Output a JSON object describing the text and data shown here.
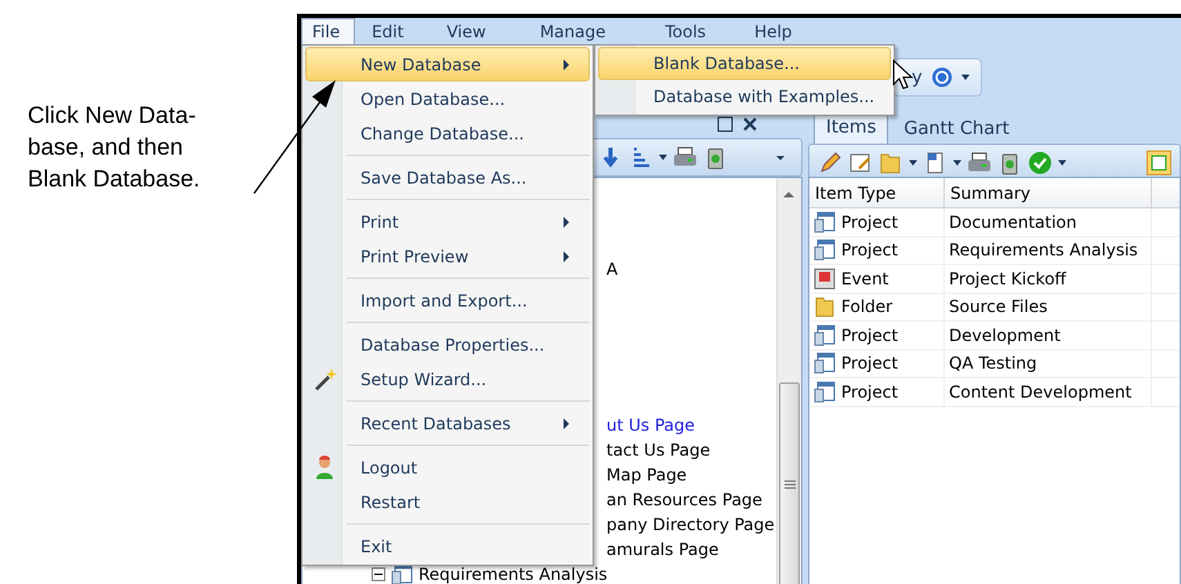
{
  "callout": {
    "text": "Click New Data-\nbase, and then\nBlank Database."
  },
  "menubar": [
    {
      "label": "File",
      "selected": true
    },
    {
      "label": "Edit",
      "selected": false
    },
    {
      "label": "View",
      "selected": false
    },
    {
      "label": "Manage",
      "selected": false
    },
    {
      "label": "Tools",
      "selected": false
    },
    {
      "label": "Help",
      "selected": false
    }
  ],
  "file_menu": {
    "groups": [
      [
        {
          "label": "New Database",
          "kind": "plain",
          "submenu": true,
          "selected": true
        },
        {
          "label": "Open Database...",
          "kind": "plain",
          "submenu": false,
          "selected": false
        },
        {
          "label": "Change Database...",
          "kind": "plain",
          "submenu": false,
          "selected": false
        }
      ],
      [
        {
          "label": "Save Database As...",
          "kind": "plain",
          "submenu": false,
          "selected": false
        }
      ],
      [
        {
          "label": "Print",
          "kind": "plain",
          "submenu": true,
          "selected": false
        },
        {
          "label": "Print Preview",
          "kind": "plain",
          "submenu": true,
          "selected": false
        }
      ],
      [
        {
          "label": "Import and Export...",
          "kind": "plain",
          "submenu": false,
          "selected": false
        }
      ],
      [
        {
          "label": "Database Properties...",
          "kind": "plain",
          "submenu": false,
          "selected": false
        },
        {
          "label": "Setup Wizard...",
          "kind": "wand",
          "submenu": false,
          "selected": false
        }
      ],
      [
        {
          "label": "Recent Databases",
          "kind": "plain",
          "submenu": true,
          "selected": false
        }
      ],
      [
        {
          "label": "Logout",
          "kind": "user",
          "submenu": false,
          "selected": false
        },
        {
          "label": "Restart",
          "kind": "plain",
          "submenu": false,
          "selected": false
        }
      ],
      [
        {
          "label": "Exit",
          "kind": "plain",
          "submenu": false,
          "selected": false
        }
      ]
    ]
  },
  "submenu": [
    {
      "label": "Blank Database...",
      "selected": true
    },
    {
      "label": "Database with Examples...",
      "selected": false
    }
  ],
  "top_toolbar": {
    "button_label": "y"
  },
  "left_pane": {
    "tree": [
      {
        "label": "A",
        "kind": "page",
        "selected": false
      },
      {
        "label": "ut Us Page",
        "kind": "page",
        "selected": true
      },
      {
        "label": "tact Us Page",
        "kind": "page",
        "selected": false
      },
      {
        "label": "Map Page",
        "kind": "page",
        "selected": false
      },
      {
        "label": "an Resources Page",
        "kind": "page",
        "selected": false
      },
      {
        "label": "pany Directory Page",
        "kind": "page",
        "selected": false
      },
      {
        "label": "amurals Page",
        "kind": "page",
        "selected": false
      },
      {
        "label": "Requirements Analysis",
        "kind": "node",
        "selected": false,
        "expanded": true
      }
    ]
  },
  "right_pane": {
    "tabs": [
      {
        "label": "Items",
        "selected": true
      },
      {
        "label": "Gantt Chart",
        "selected": false
      }
    ],
    "table": {
      "columns": [
        "Item Type",
        "Summary"
      ],
      "rows": [
        {
          "kind": "project",
          "item_type": "Project",
          "summary": "Documentation"
        },
        {
          "kind": "project",
          "item_type": "Project",
          "summary": "Requirements Analysis"
        },
        {
          "kind": "event",
          "item_type": "Event",
          "summary": "Project Kickoff"
        },
        {
          "kind": "folder",
          "item_type": "Folder",
          "summary": "Source Files"
        },
        {
          "kind": "project",
          "item_type": "Project",
          "summary": "Development"
        },
        {
          "kind": "project",
          "item_type": "Project",
          "summary": "QA Testing"
        },
        {
          "kind": "project",
          "item_type": "Project",
          "summary": "Content Development"
        }
      ]
    }
  }
}
